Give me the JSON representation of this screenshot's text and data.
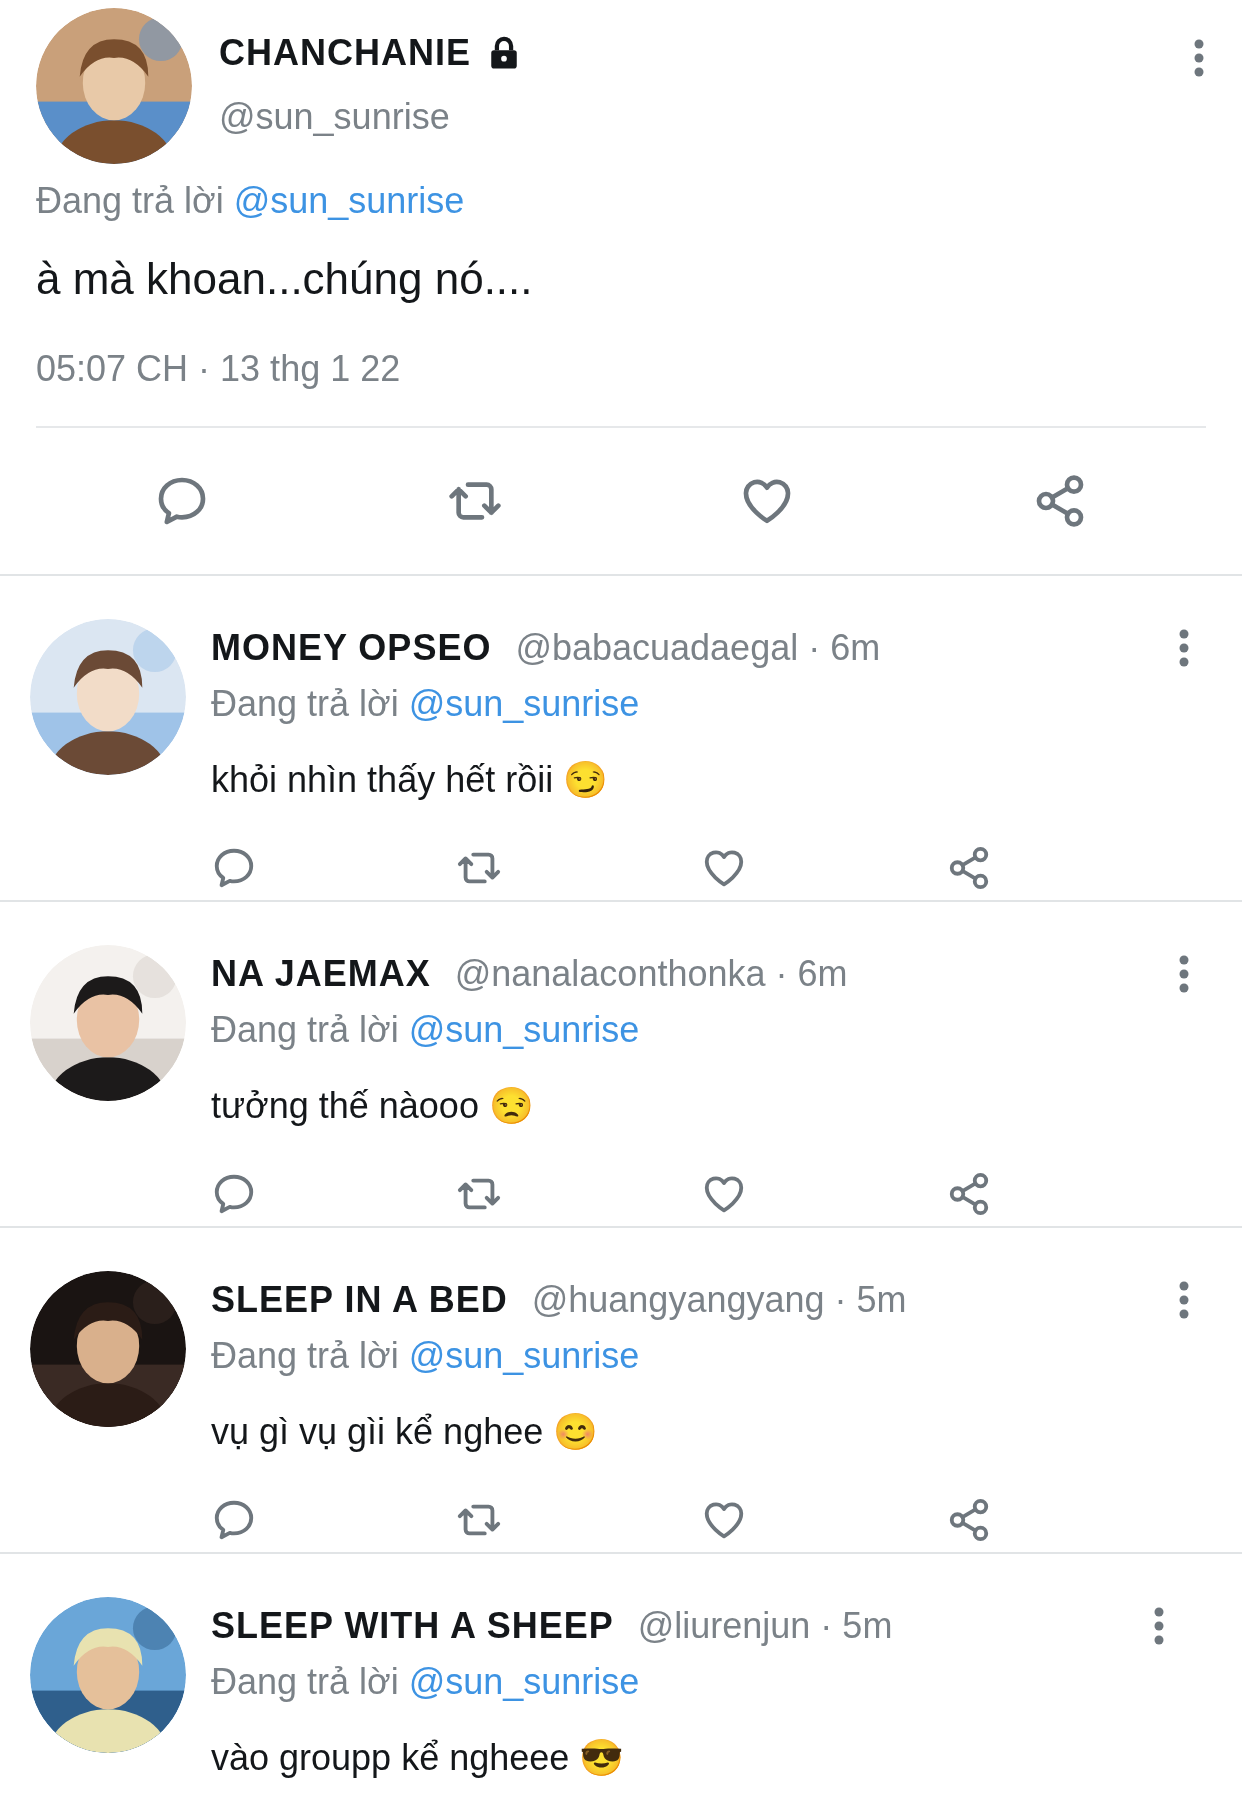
{
  "tweet": {
    "name": "CHANCHANIE",
    "protected": true,
    "handle": "@sun_sunrise",
    "reply_label": "Đang trả lời",
    "reply_to": "@sun_sunrise",
    "text": "à mà khoan...chúng nó....",
    "timestamp": "05:07 CH · 13 thg 1 22"
  },
  "replies": [
    {
      "name": "MONEY OPSEO",
      "meta": "@babacuadaegal · 6m",
      "reply_label": "Đang trả lời",
      "reply_to": "@sun_sunrise",
      "text": "khỏi nhìn thấy hết rồii 😏"
    },
    {
      "name": "NA JAEMAX",
      "meta": "@nanalaconthonka · 6m",
      "reply_label": "Đang trả lời",
      "reply_to": "@sun_sunrise",
      "text": "tưởng thế nàooo 😒"
    },
    {
      "name": "SLEEP IN A BED",
      "meta": "@huangyangyang · 5m",
      "reply_label": "Đang trả lời",
      "reply_to": "@sun_sunrise",
      "text": "vụ gì vụ gìi kể nghee 😊"
    },
    {
      "name": "SLEEP WITH A SHEEP",
      "meta": "@liurenjun · 5m",
      "reply_label": "Đang trả lời",
      "reply_to": "@sun_sunrise",
      "text": "vào groupp kể ngheee 😎"
    }
  ]
}
